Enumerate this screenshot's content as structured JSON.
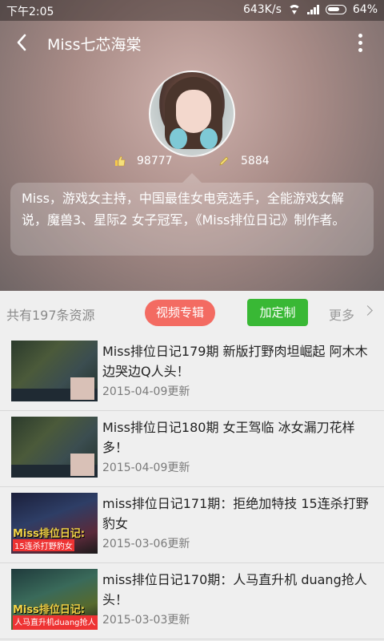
{
  "status_bar": {
    "time": "下午2:05",
    "speed": "643K/s",
    "battery": "64%"
  },
  "header": {
    "title": "Miss七芯海棠"
  },
  "profile": {
    "likes": "98777",
    "count2": "5884",
    "bio": "Miss，游戏女主持，中国最佳女电竞选手，全能游戏女解说，魔兽3、星际2 女子冠军，《Miss排位日记》制作者。"
  },
  "toolbar": {
    "count_text": "共有197条资源",
    "album_label": "视频专辑",
    "custom_label": "加定制",
    "more_label": "更多"
  },
  "videos": [
    {
      "title": "Miss排位日记179期 新版打野肉坦崛起 阿木木边哭边Q人头！",
      "date": "2015-04-09更新",
      "thumb_caption": "",
      "thumb_sub": ""
    },
    {
      "title": "Miss排位日记180期 女王驾临 冰女漏刀花样多！",
      "date": "2015-04-09更新",
      "thumb_caption": "",
      "thumb_sub": ""
    },
    {
      "title": "miss排位日记171期：拒绝加特技 15连杀打野豹女",
      "date": "2015-03-06更新",
      "thumb_caption": "Miss排位日记:",
      "thumb_sub": "15连杀打野豹女"
    },
    {
      "title": "miss排位日记170期：人马直升机 duang抢人头！",
      "date": "2015-03-03更新",
      "thumb_caption": "Miss排位日记:",
      "thumb_sub": "人马直升机duang抢人头"
    }
  ]
}
